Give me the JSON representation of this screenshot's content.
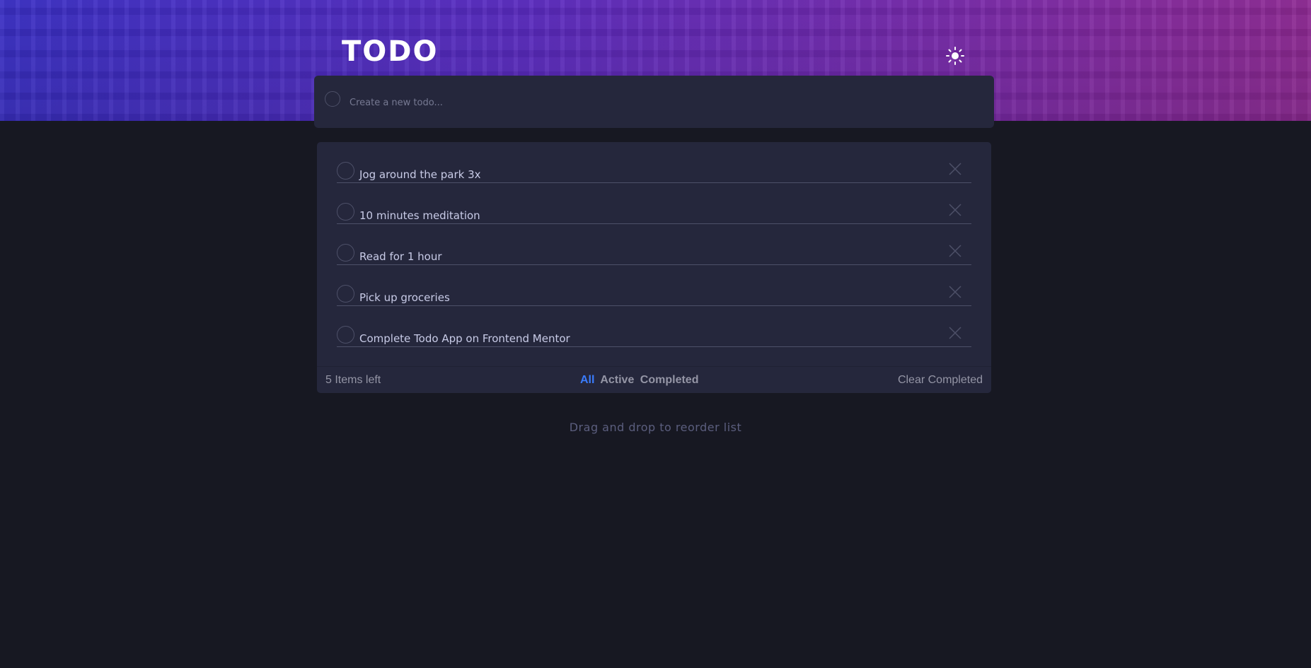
{
  "header": {
    "title": "TODO",
    "theme_toggle_icon": "sun-icon"
  },
  "new_todo": {
    "placeholder": "Create a new todo..."
  },
  "todos": [
    {
      "text": "Jog around the park 3x"
    },
    {
      "text": "10 minutes meditation"
    },
    {
      "text": "Read for 1 hour"
    },
    {
      "text": "Pick up groceries"
    },
    {
      "text": "Complete Todo App on Frontend Mentor"
    }
  ],
  "footer": {
    "items_left": "5 Items left",
    "filters": {
      "all": "All",
      "active": "Active",
      "completed": "Completed"
    },
    "selected_filter": "All",
    "clear_completed": "Clear Completed"
  },
  "hint": "Drag and drop to reorder list",
  "colors": {
    "background": "#171822",
    "card": "#25273c",
    "text": "#c8cbe7",
    "muted": "#9495a5",
    "accent": "#3a7cfd",
    "gradient_start": "#3a2fc4",
    "gradient_end": "#8e2a93"
  }
}
